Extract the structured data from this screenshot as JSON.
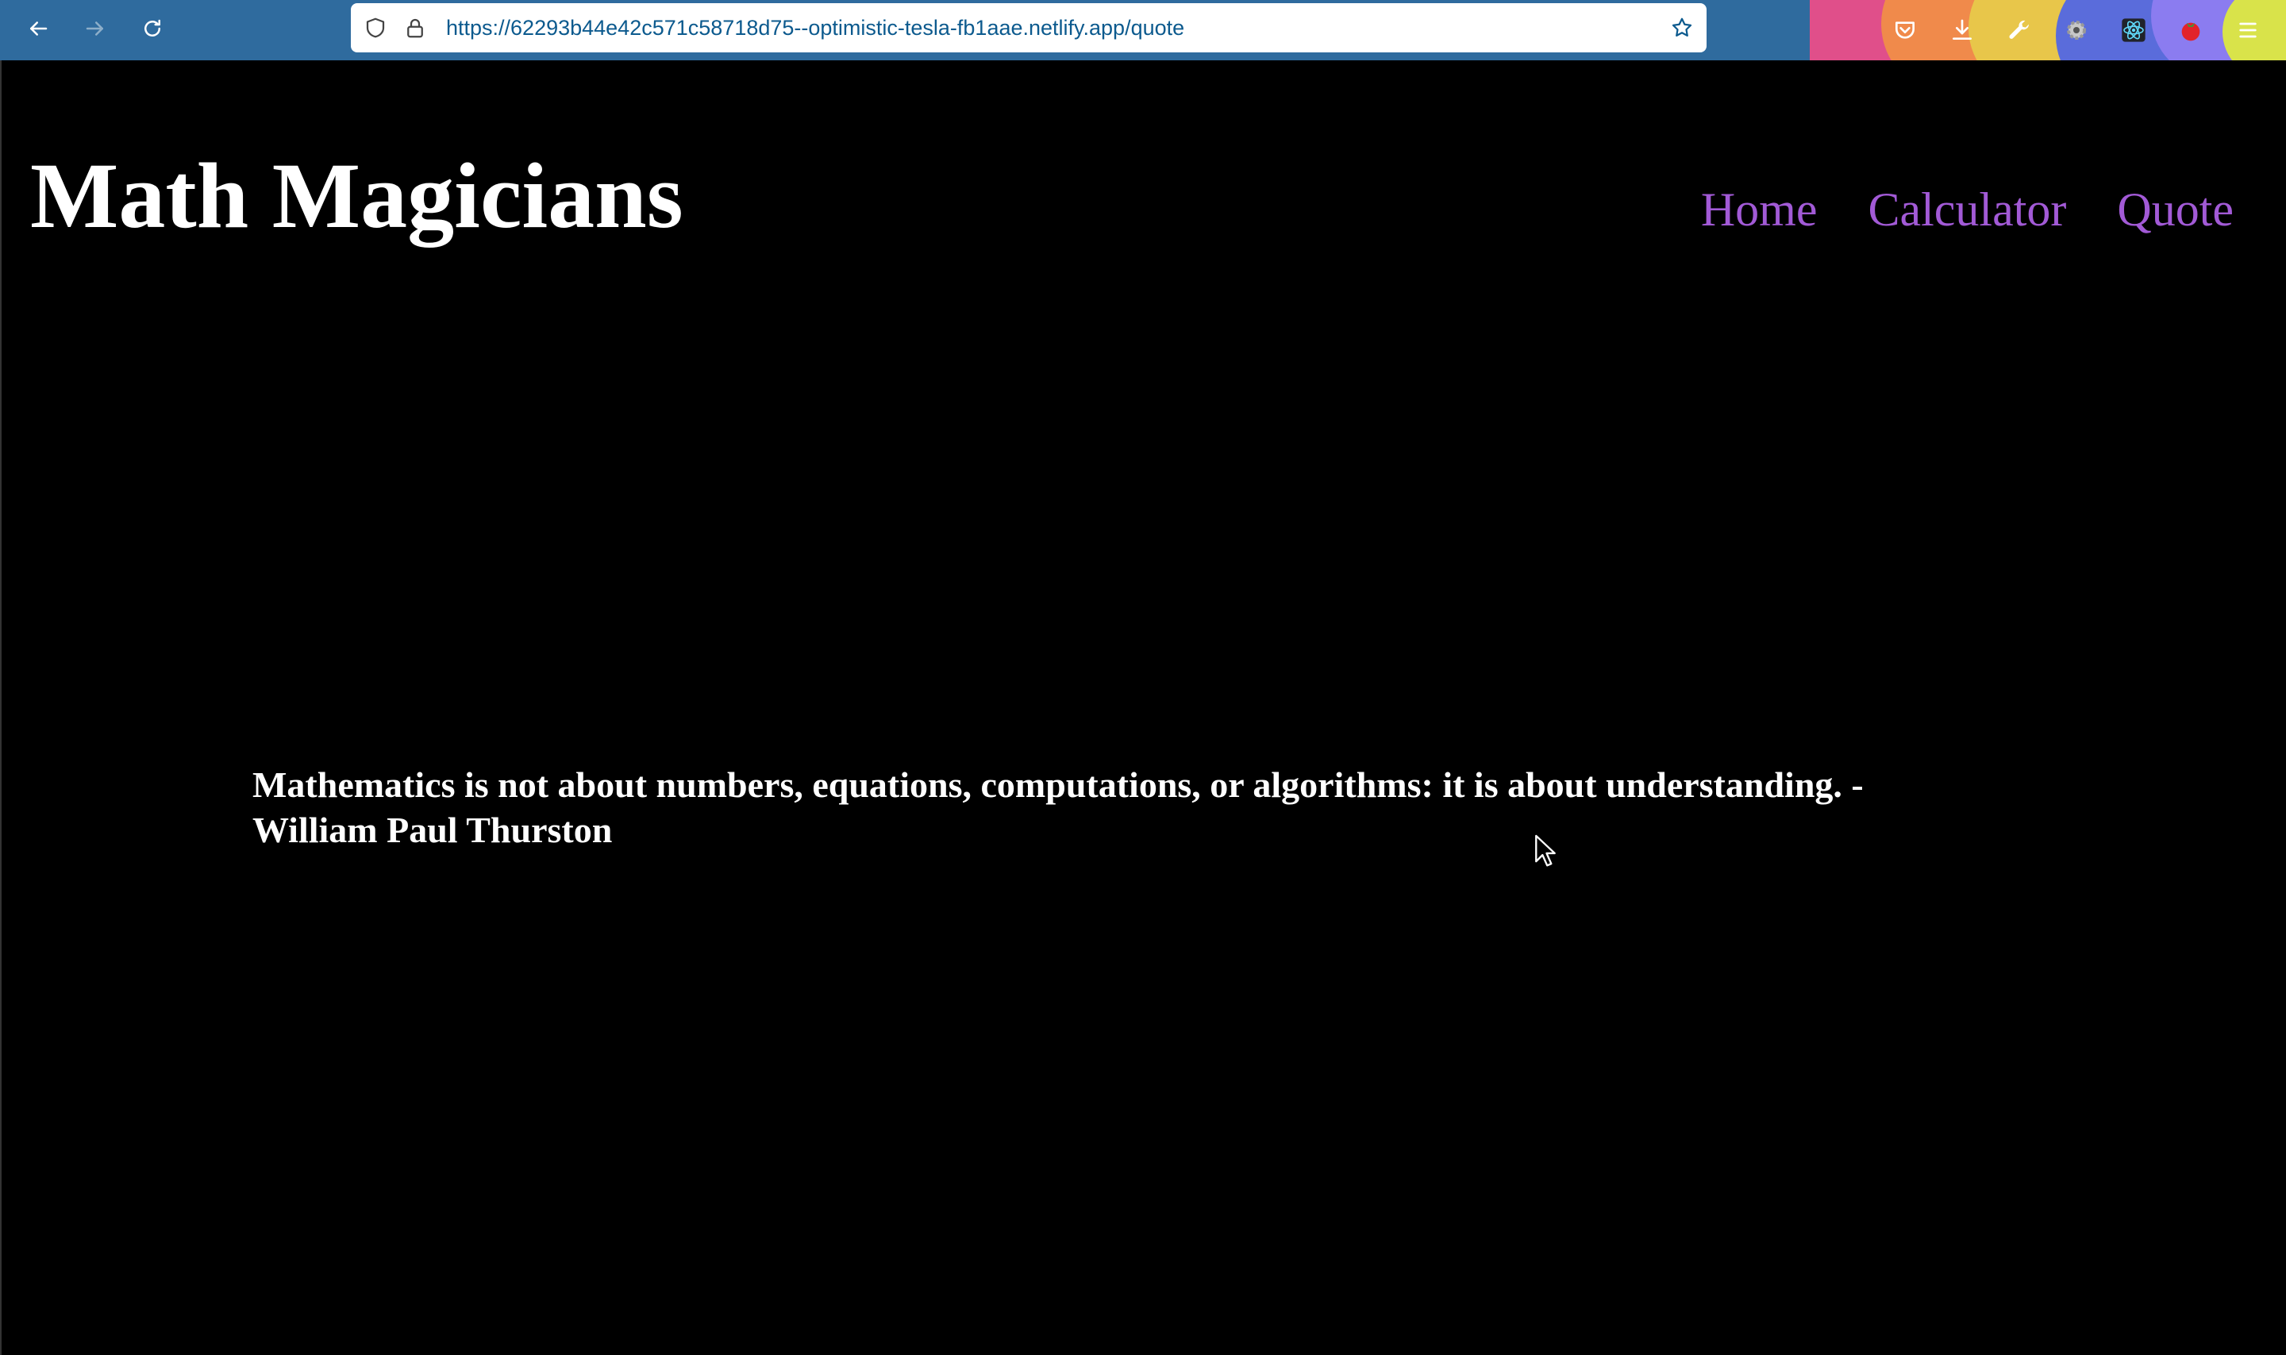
{
  "browser": {
    "url": "https://62293b44e42c571c58718d75--optimistic-tesla-fb1aae.netlify.app/quote",
    "nav_icons": [
      "back-arrow-icon",
      "forward-arrow-icon",
      "reload-icon"
    ],
    "url_icons": [
      "shield-icon",
      "lock-icon",
      "star-icon"
    ],
    "toolbar_icons": [
      "pocket-icon",
      "download-icon",
      "wrench-icon",
      "gear-extension-icon",
      "react-devtools-icon",
      "tomato-extension-icon",
      "menu-icon"
    ]
  },
  "site": {
    "title": "Math Magicians",
    "nav": [
      "Home",
      "Calculator",
      "Quote"
    ],
    "nav_color": "#a25ad6"
  },
  "quote": {
    "text": "Mathematics is not about numbers, equations, computations, or algorithms: it is about understanding. - William Paul Thurston"
  }
}
